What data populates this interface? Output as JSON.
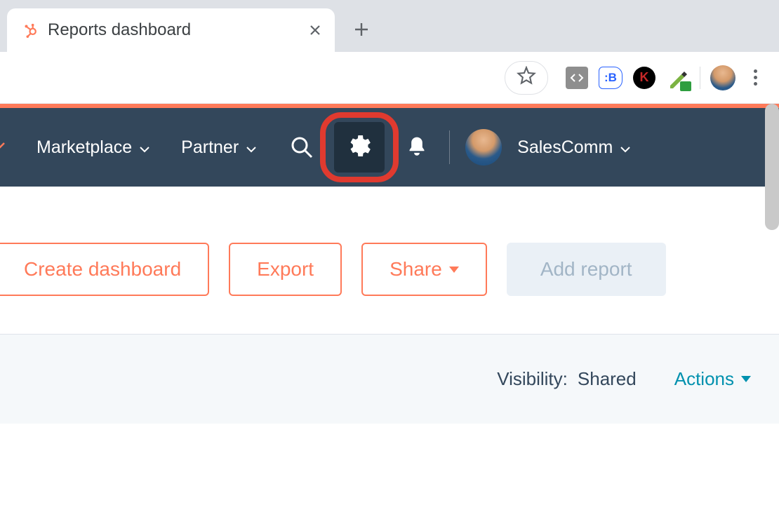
{
  "browser": {
    "tab_title": "Reports dashboard",
    "favicon": "hubspot-icon"
  },
  "extensions": {
    "code_icon": "code-ext-icon",
    "blue_icon": "blue-ext-icon",
    "k_icon": "k-ext-icon",
    "dropper_icon": "color-picker-ext-icon"
  },
  "nav": {
    "items": [
      {
        "label": "Marketplace"
      },
      {
        "label": "Partner"
      }
    ],
    "account": "SalesComm"
  },
  "actions": {
    "create_dashboard": "Create dashboard",
    "export": "Export",
    "share": "Share",
    "add_report": "Add report"
  },
  "visibility": {
    "label": "Visibility:",
    "value": "Shared",
    "actions_label": "Actions"
  },
  "colors": {
    "accent": "#ff7a59",
    "nav_bg": "#33475b",
    "link": "#0091ae"
  }
}
